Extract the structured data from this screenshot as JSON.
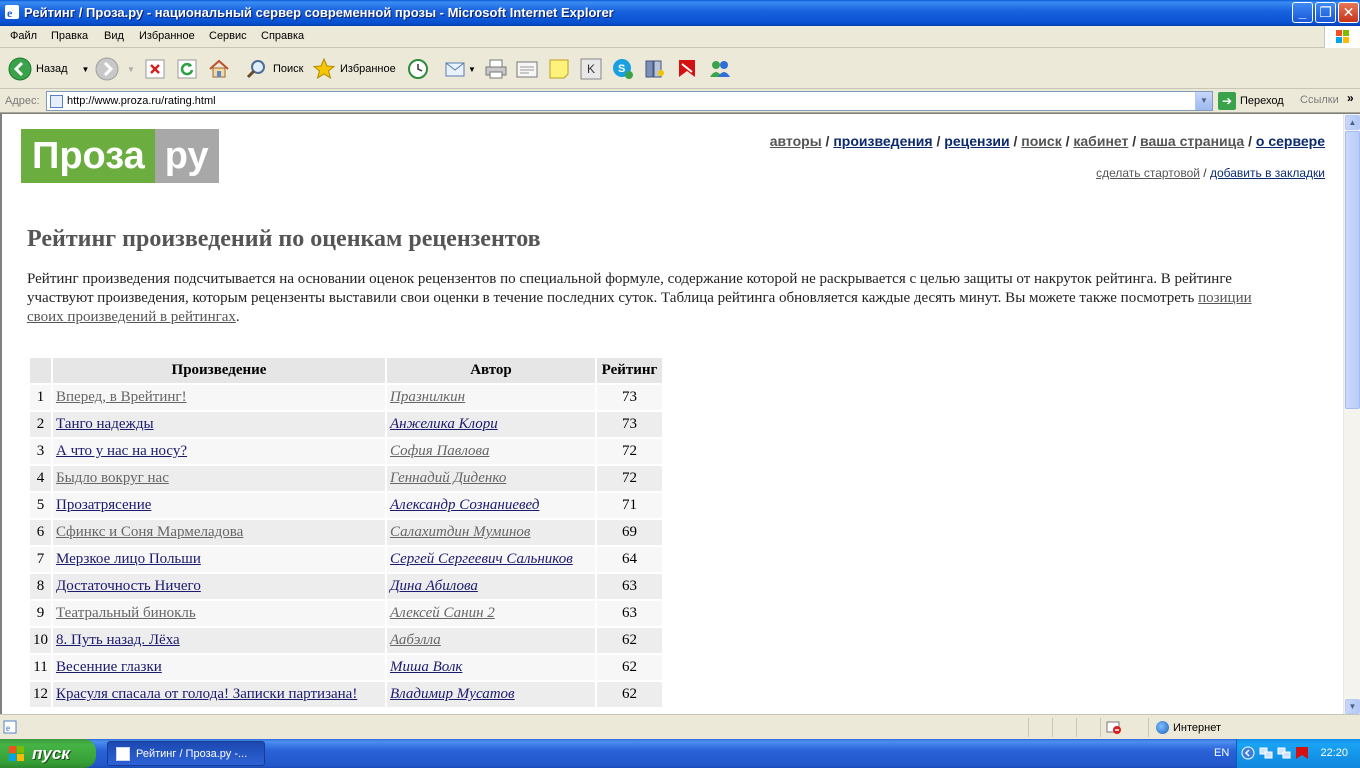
{
  "window": {
    "title": "Рейтинг / Проза.ру - национальный сервер современной прозы - Microsoft Internet Explorer"
  },
  "menu": [
    "Файл",
    "Правка",
    "Вид",
    "Избранное",
    "Сервис",
    "Справка"
  ],
  "toolbar": {
    "back_label": "Назад",
    "search_label": "Поиск",
    "favorites_label": "Избранное"
  },
  "address": {
    "label": "Адрес:",
    "url": "http://www.proza.ru/rating.html",
    "go_label": "Переход",
    "links_label": "Ссылки"
  },
  "site": {
    "logo_left": "Проза",
    "logo_right": "ру",
    "nav": [
      "авторы",
      "произведения",
      "рецензии",
      "поиск",
      "кабинет",
      "ваша страница",
      "о сервере"
    ],
    "subnav": [
      "сделать стартовой",
      "добавить в закладки"
    ]
  },
  "content": {
    "heading": "Рейтинг произведений по оценкам рецензентов",
    "intro_text": "Рейтинг произведения подсчитывается на основании оценок рецензентов по специальной формуле, содержание которой не раскрывается с целью защиты от накруток рейтинга. В рейтинге участвуют произведения, которым рецензенты выставили свои оценки в течение последних суток. Таблица рейтинга обновляется каждые десять минут. Вы можете также посмотреть ",
    "intro_link": "позиции своих произведений в рейтингах",
    "intro_end": ".",
    "table": {
      "headers": [
        "",
        "Произведение",
        "Автор",
        "Рейтинг"
      ],
      "rows": [
        {
          "n": "1",
          "work": "Вперед, в Врейтинг!",
          "author": "Празнилкин",
          "score": "73"
        },
        {
          "n": "2",
          "work": "Танго надежды",
          "author": "Анжелика Клори",
          "score": "73"
        },
        {
          "n": "3",
          "work": "А что у нас на носу?",
          "author": "София Павлова",
          "score": "72"
        },
        {
          "n": "4",
          "work": "Быдло вокруг нас",
          "author": "Геннадий Диденко",
          "score": "72"
        },
        {
          "n": "5",
          "work": "Прозатрясение",
          "author": "Александр Сознаниевед",
          "score": "71"
        },
        {
          "n": "6",
          "work": "Сфинкс и Соня Мармеладова",
          "author": "Салахитдин Муминов",
          "score": "69"
        },
        {
          "n": "7",
          "work": "Мерзкое лицо Польши",
          "author": "Сергей Сергеевич Сальников",
          "score": "64"
        },
        {
          "n": "8",
          "work": "Достаточность Ничего",
          "author": "Дина Абилова",
          "score": "63"
        },
        {
          "n": "9",
          "work": "Театральный бинокль",
          "author": "Алексей Санин 2",
          "score": "63"
        },
        {
          "n": "10",
          "work": "8. Путь назад. Лёха",
          "author": "Аабэлла",
          "score": "62"
        },
        {
          "n": "11",
          "work": "Весенние глазки",
          "author": "Миша Волк",
          "score": "62"
        },
        {
          "n": "12",
          "work": "Красуля спасала от голода! Записки партизана!",
          "author": "Владимир Мусатов",
          "score": "62"
        }
      ]
    }
  },
  "status": {
    "zone": "Интернет"
  },
  "taskbar": {
    "start_label": "пуск",
    "task_title": "Рейтинг / Проза.ру -...",
    "lang": "EN",
    "time": "22:20"
  }
}
